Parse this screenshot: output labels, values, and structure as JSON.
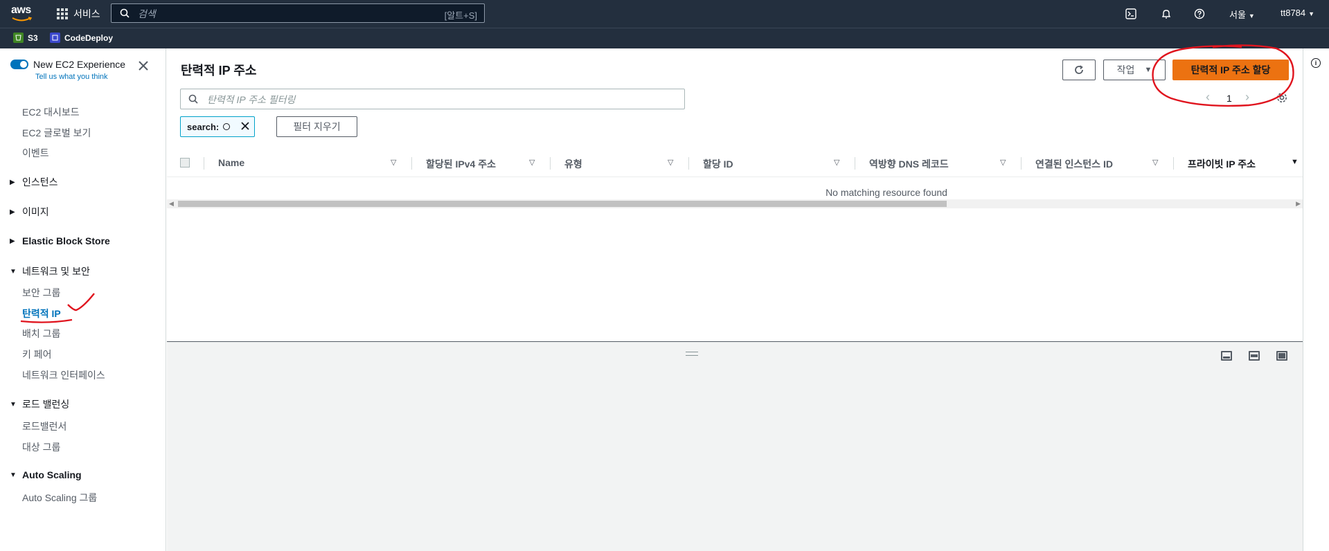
{
  "topnav": {
    "logo_text": "aws",
    "services_label": "서비스",
    "search_placeholder": "검색",
    "search_shortcut": "[알트+S]",
    "region": "서울",
    "account": "tt8784"
  },
  "favorites": [
    {
      "label": "S3",
      "color": "#3f8624"
    },
    {
      "label": "CodeDeploy",
      "color": "#3b48cc"
    }
  ],
  "sidebar": {
    "experience_title": "New EC2 Experience",
    "experience_sub": "Tell us what you think",
    "items": {
      "dashboard": "EC2 대시보드",
      "global_view": "EC2 글로벌 보기",
      "events": "이벤트",
      "instances": "인스턴스",
      "images": "이미지",
      "ebs": "Elastic Block Store",
      "network_security": "네트워크 및 보안",
      "security_groups": "보안 그룹",
      "elastic_ip": "탄력적 IP",
      "placement_groups": "배치 그룹",
      "key_pairs": "키 페어",
      "network_interfaces": "네트워크 인터페이스",
      "load_balancing": "로드 밸런싱",
      "load_balancers": "로드밸런서",
      "target_groups": "대상 그룹",
      "auto_scaling": "Auto Scaling",
      "auto_scaling_groups": "Auto Scaling 그룹"
    }
  },
  "main": {
    "title": "탄력적 IP 주소",
    "actions_label": "작업",
    "allocate_label": "탄력적 IP 주소 할당",
    "filter_placeholder": "탄력적 IP 주소 필터링",
    "page_number": "1",
    "token_label": "search:",
    "clear_filters_label": "필터 지우기",
    "columns": [
      "Name",
      "할당된 IPv4 주소",
      "유형",
      "할당 ID",
      "역방향 DNS 레코드",
      "연결된 인스턴스 ID",
      "프라이빗 IP 주소"
    ],
    "empty_message": "No matching resource found"
  },
  "colors": {
    "nav_bg": "#232f3e",
    "accent": "#0073bb",
    "primary_button": "#ec7211",
    "annotation": "#e0141e"
  }
}
